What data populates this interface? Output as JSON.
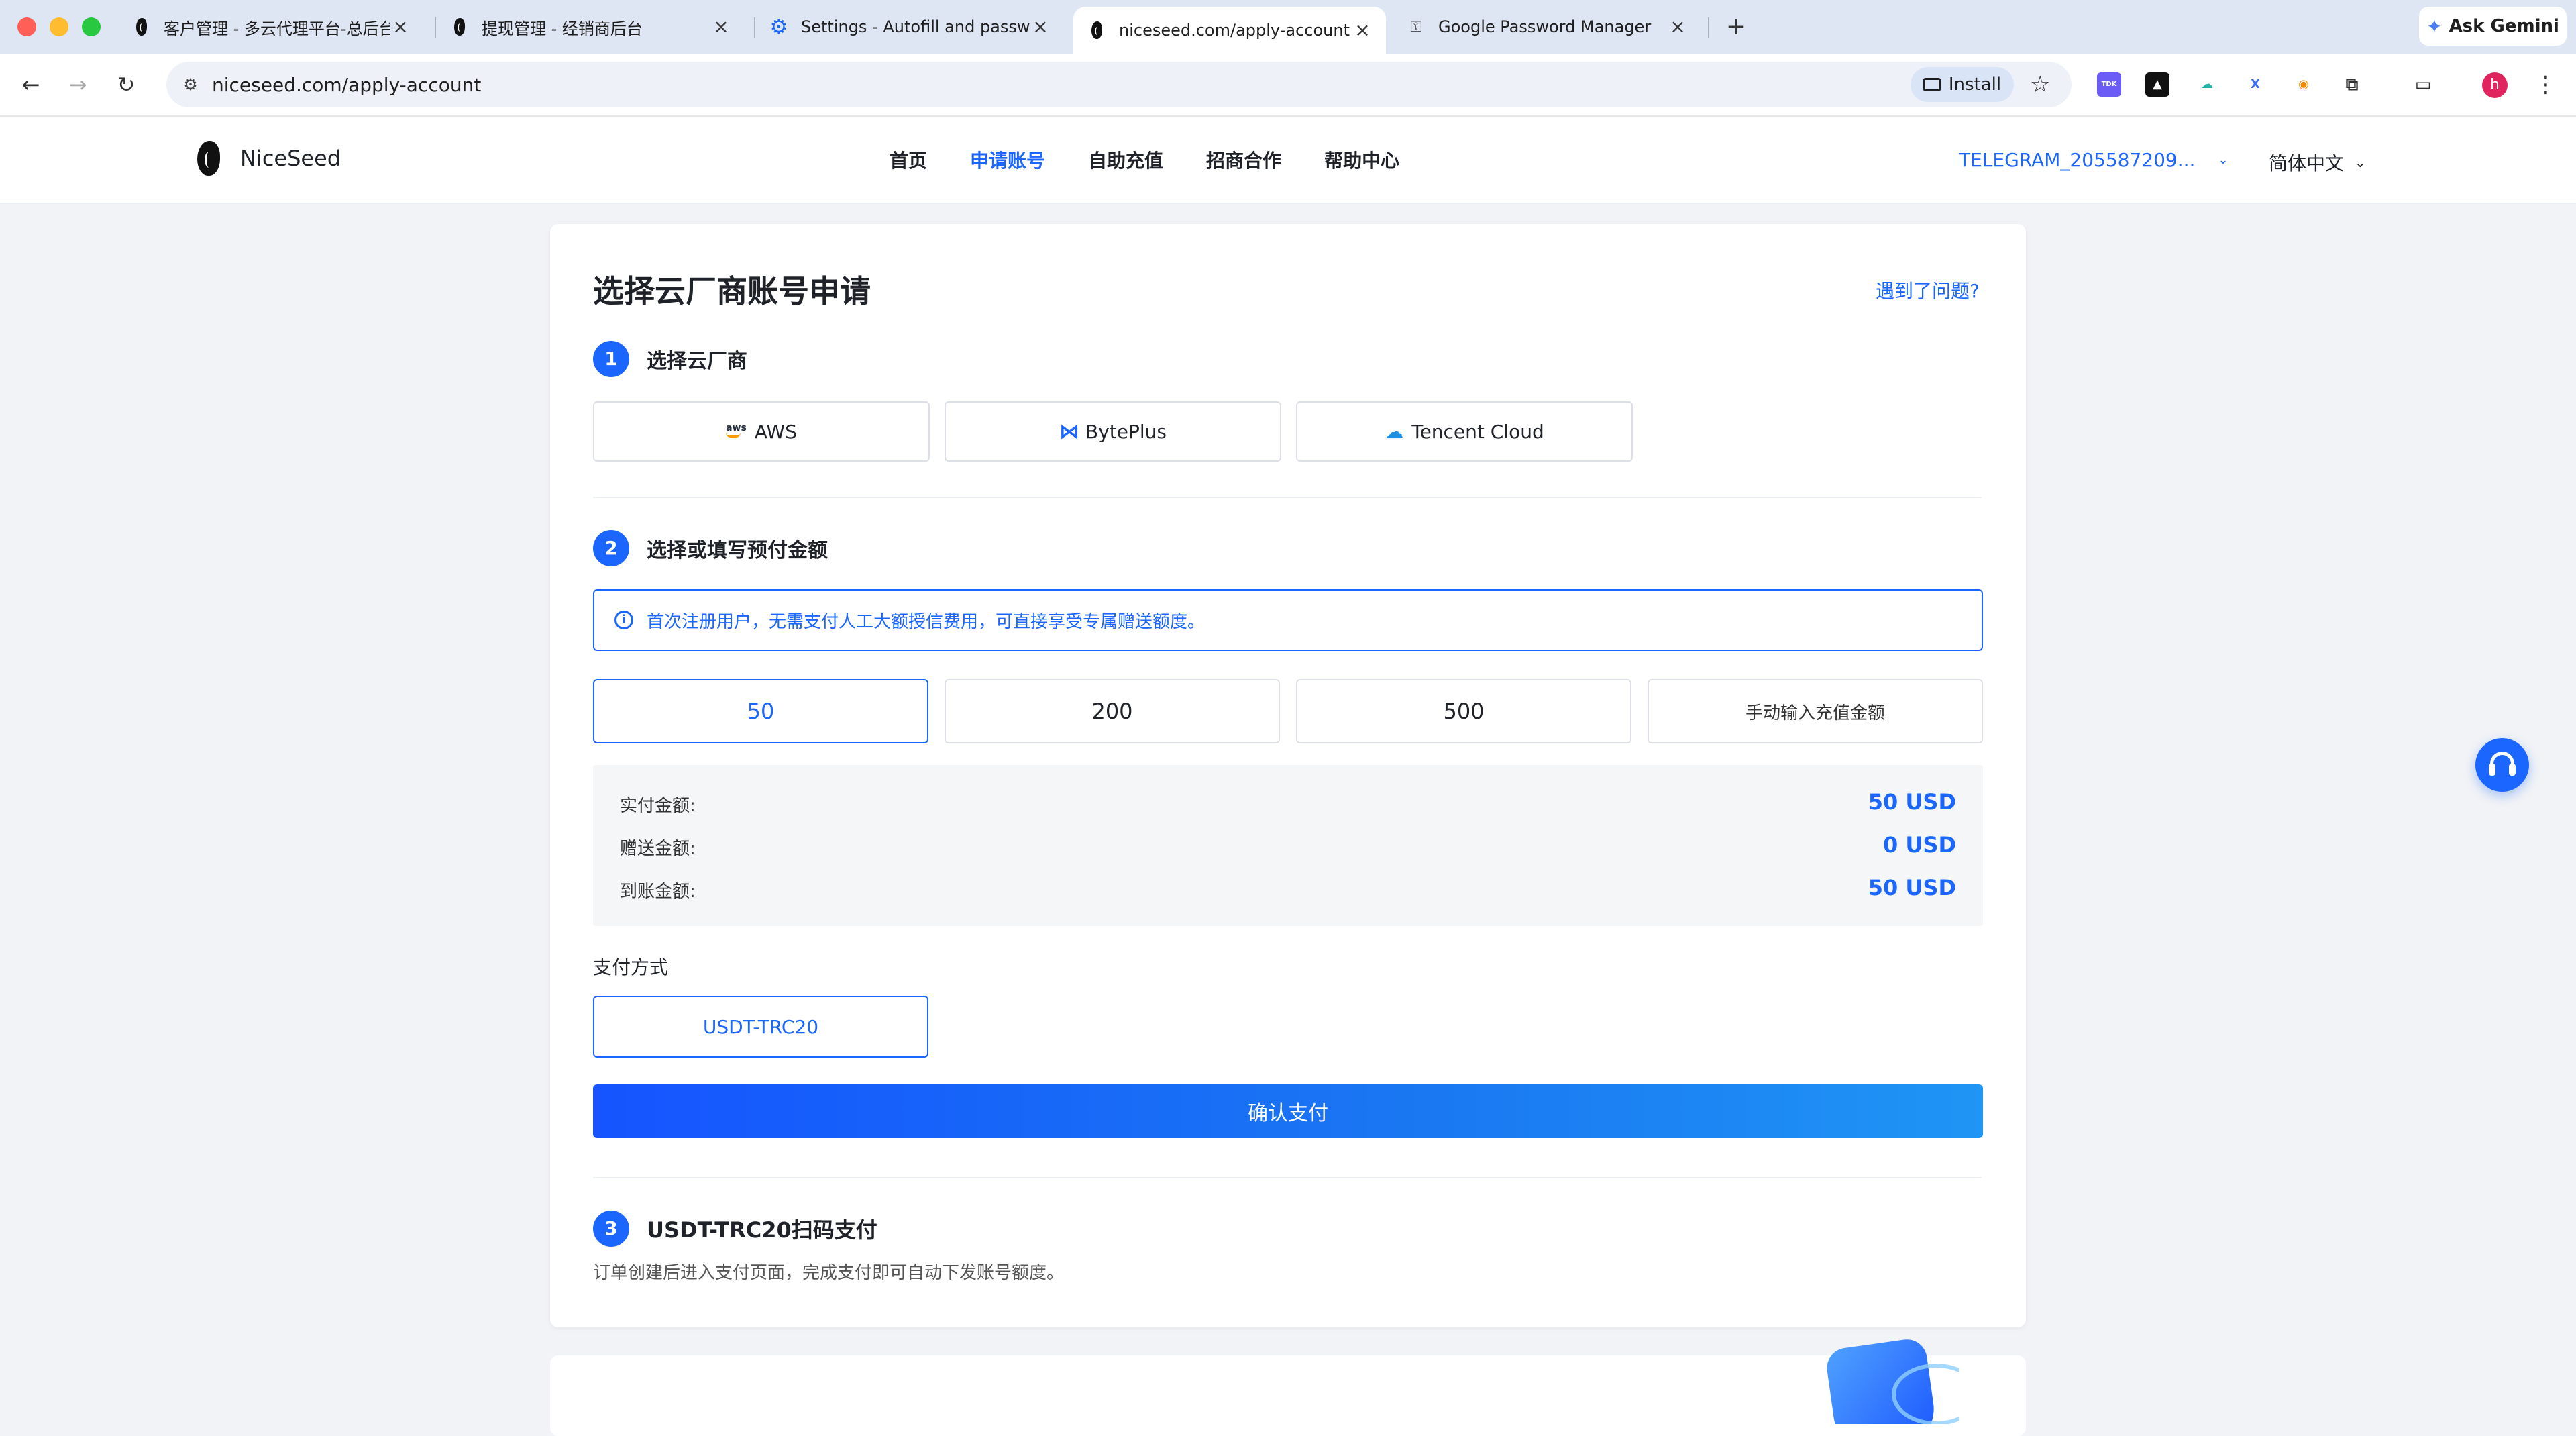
{
  "browser": {
    "tabs": [
      {
        "title": "客户管理 - 多云代理平台-总后台"
      },
      {
        "title": "提现管理 - 经销商后台"
      },
      {
        "title": "Settings - Autofill and passwords"
      },
      {
        "title": "niceseed.com/apply-account"
      },
      {
        "title": "Google Password Manager"
      }
    ],
    "url": "niceseed.com/apply-account",
    "install_label": "Install",
    "ask_gemini_label": "Ask Gemini",
    "profile_initial": "h",
    "extension_label": "TDK"
  },
  "site": {
    "brand": "NiceSeed",
    "nav": [
      "首页",
      "申请账号",
      "自助充值",
      "招商合作",
      "帮助中心"
    ],
    "user": "TELEGRAM_205587209...",
    "language": "简体中文"
  },
  "card": {
    "title": "选择云厂商账号申请",
    "help_link": "遇到了问题?",
    "step1": {
      "num": "1",
      "label": "选择云厂商",
      "providers": [
        "AWS",
        "BytePlus",
        "Tencent Cloud"
      ]
    },
    "step2": {
      "num": "2",
      "label": "选择或填写预付金额",
      "notice": "首次注册用户，无需支付人工大额授信费用，可直接享受专属赠送额度。",
      "amounts": [
        "50",
        "200",
        "500"
      ],
      "custom_amount": "手动输入充值金额",
      "summary": [
        {
          "label": "实付金额:",
          "value": "50 USD"
        },
        {
          "label": "赠送金额:",
          "value": "0 USD"
        },
        {
          "label": "到账金额:",
          "value": "50 USD"
        }
      ],
      "payment_label": "支付方式",
      "payment_method": "USDT-TRC20",
      "confirm": "确认支付"
    },
    "step3": {
      "num": "3",
      "label": "USDT-TRC20扫码支付",
      "desc": "订单创建后进入支付页面，完成支付即可自动下发账号额度。"
    }
  },
  "colors": {
    "accent": "#1a66ff",
    "tabbar": "#dee6f3",
    "page_bg": "#f1f3f6"
  }
}
